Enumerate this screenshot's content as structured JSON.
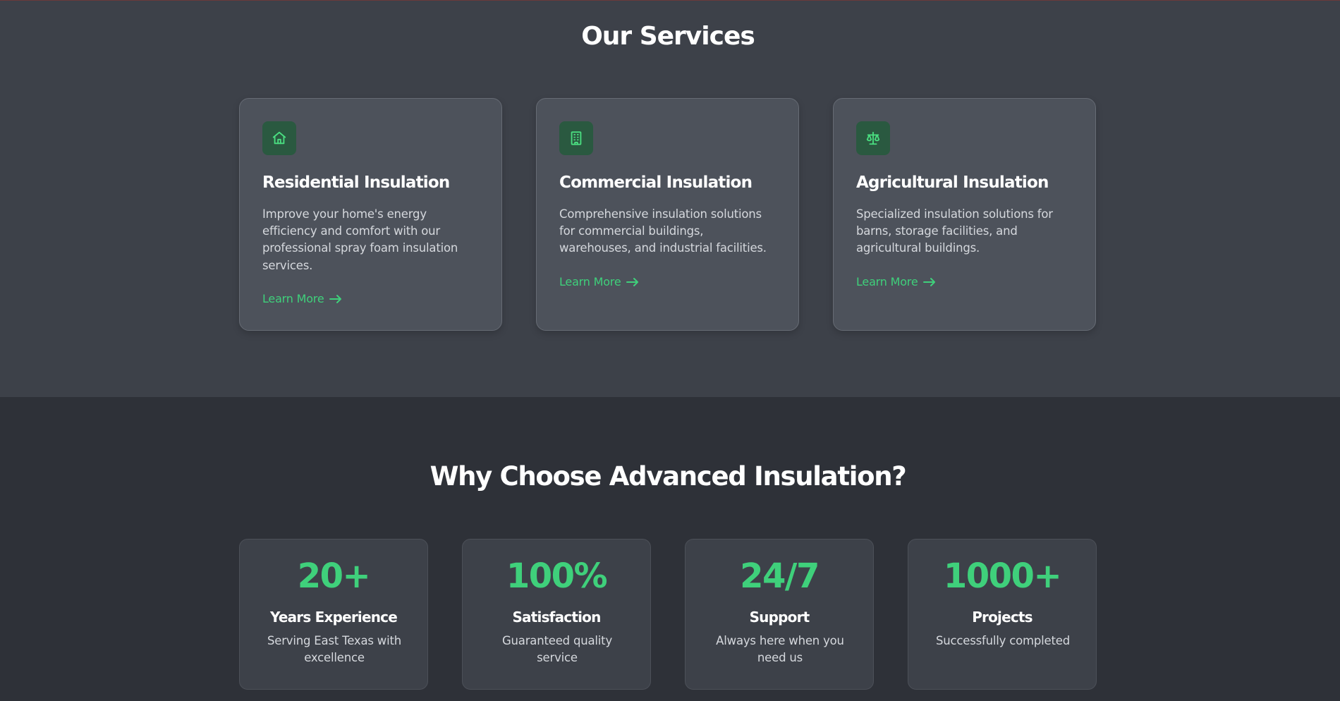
{
  "services": {
    "title": "Our Services",
    "cards": [
      {
        "icon": "home-icon",
        "title": "Residential Insulation",
        "description": "Improve your home's energy efficiency and comfort with our professional spray foam insulation services.",
        "link": "Learn More"
      },
      {
        "icon": "building-icon",
        "title": "Commercial Insulation",
        "description": "Comprehensive insulation solutions for commercial buildings, warehouses, and industrial facilities.",
        "link": "Learn More"
      },
      {
        "icon": "scale-icon",
        "title": "Agricultural Insulation",
        "description": "Specialized insulation solutions for barns, storage facilities, and agricultural buildings.",
        "link": "Learn More"
      }
    ]
  },
  "why": {
    "title": "Why Choose Advanced Insulation?",
    "stats": [
      {
        "value": "20+",
        "label": "Years Experience",
        "description": "Serving East Texas with excellence"
      },
      {
        "value": "100%",
        "label": "Satisfaction",
        "description": "Guaranteed quality service"
      },
      {
        "value": "24/7",
        "label": "Support",
        "description": "Always here when you need us"
      },
      {
        "value": "1000+",
        "label": "Projects",
        "description": "Successfully completed"
      }
    ]
  },
  "colors": {
    "accent": "#3fd07b",
    "services_bg": "#3d4149",
    "page_bg": "#2e3138",
    "card_bg": "#4d525b",
    "icon_bg": "#2a5940"
  }
}
